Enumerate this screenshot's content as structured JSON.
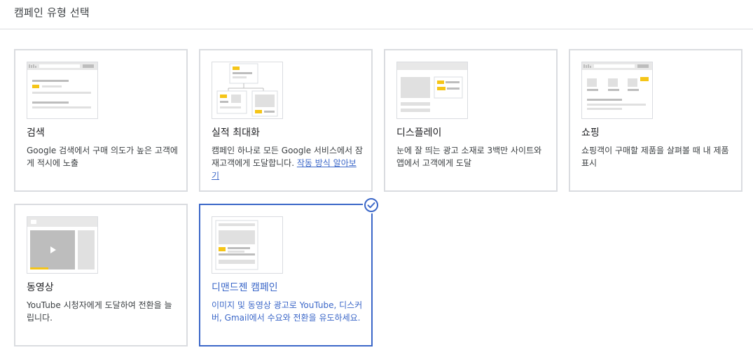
{
  "header": {
    "title": "캠페인 유형 선택"
  },
  "colors": {
    "accent": "#3b67c8",
    "yellow": "#f5c518",
    "border": "#dadce0",
    "mock_gray": "#e0e0e0"
  },
  "cards": [
    {
      "id": "search",
      "title": "검색",
      "description": "Google 검색에서 구매 의도가 높은 고객에게 적시에 노출",
      "icon": "search-illustration-icon",
      "selected": false
    },
    {
      "id": "performance_max",
      "title": "실적 최대화",
      "description": "캠페인 하나로 모든 Google 서비스에서 잠재고객에게 도달합니다. ",
      "link_text": "작동 방식 알아보기",
      "icon": "performance-max-illustration-icon",
      "selected": false
    },
    {
      "id": "display",
      "title": "디스플레이",
      "description": "눈에 잘 띄는 광고 소재로 3백만 사이트와 앱에서 고객에게 도달",
      "icon": "display-illustration-icon",
      "selected": false
    },
    {
      "id": "shopping",
      "title": "쇼핑",
      "description": "쇼핑객이 구매할 제품을 살펴볼 때 내 제품 표시",
      "icon": "shopping-illustration-icon",
      "selected": false
    },
    {
      "id": "video",
      "title": "동영상",
      "description": "YouTube 시청자에게 도달하여 전환을 늘립니다.",
      "icon": "video-illustration-icon",
      "selected": false
    },
    {
      "id": "demand_gen",
      "title": "디맨드젠 캠페인",
      "description": "이미지 및 동영상 광고로 YouTube, 디스커버, Gmail에서 수요와 전환을 유도하세요.",
      "icon": "demand-gen-illustration-icon",
      "selected": true
    }
  ]
}
